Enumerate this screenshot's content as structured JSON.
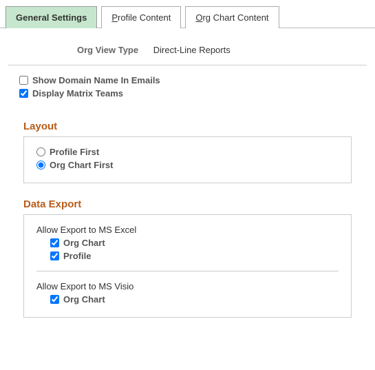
{
  "tabs": {
    "general": "General Settings",
    "profile_prefix": "P",
    "profile_rest": "rofile Content",
    "org_prefix": "O",
    "org_rest": "rg Chart Content"
  },
  "viewtype": {
    "label": "Org View Type",
    "value": "Direct-Line Reports"
  },
  "checks": {
    "domain": "Show Domain Name In Emails",
    "matrix": "Display Matrix Teams"
  },
  "layout": {
    "title": "Layout",
    "profile_first": "Profile First",
    "org_first": "Org Chart First"
  },
  "export": {
    "title": "Data Export",
    "excel": "Allow Export to MS Excel",
    "visio": "Allow Export to MS Visio",
    "orgchart": "Org Chart",
    "profile": "Profile"
  }
}
